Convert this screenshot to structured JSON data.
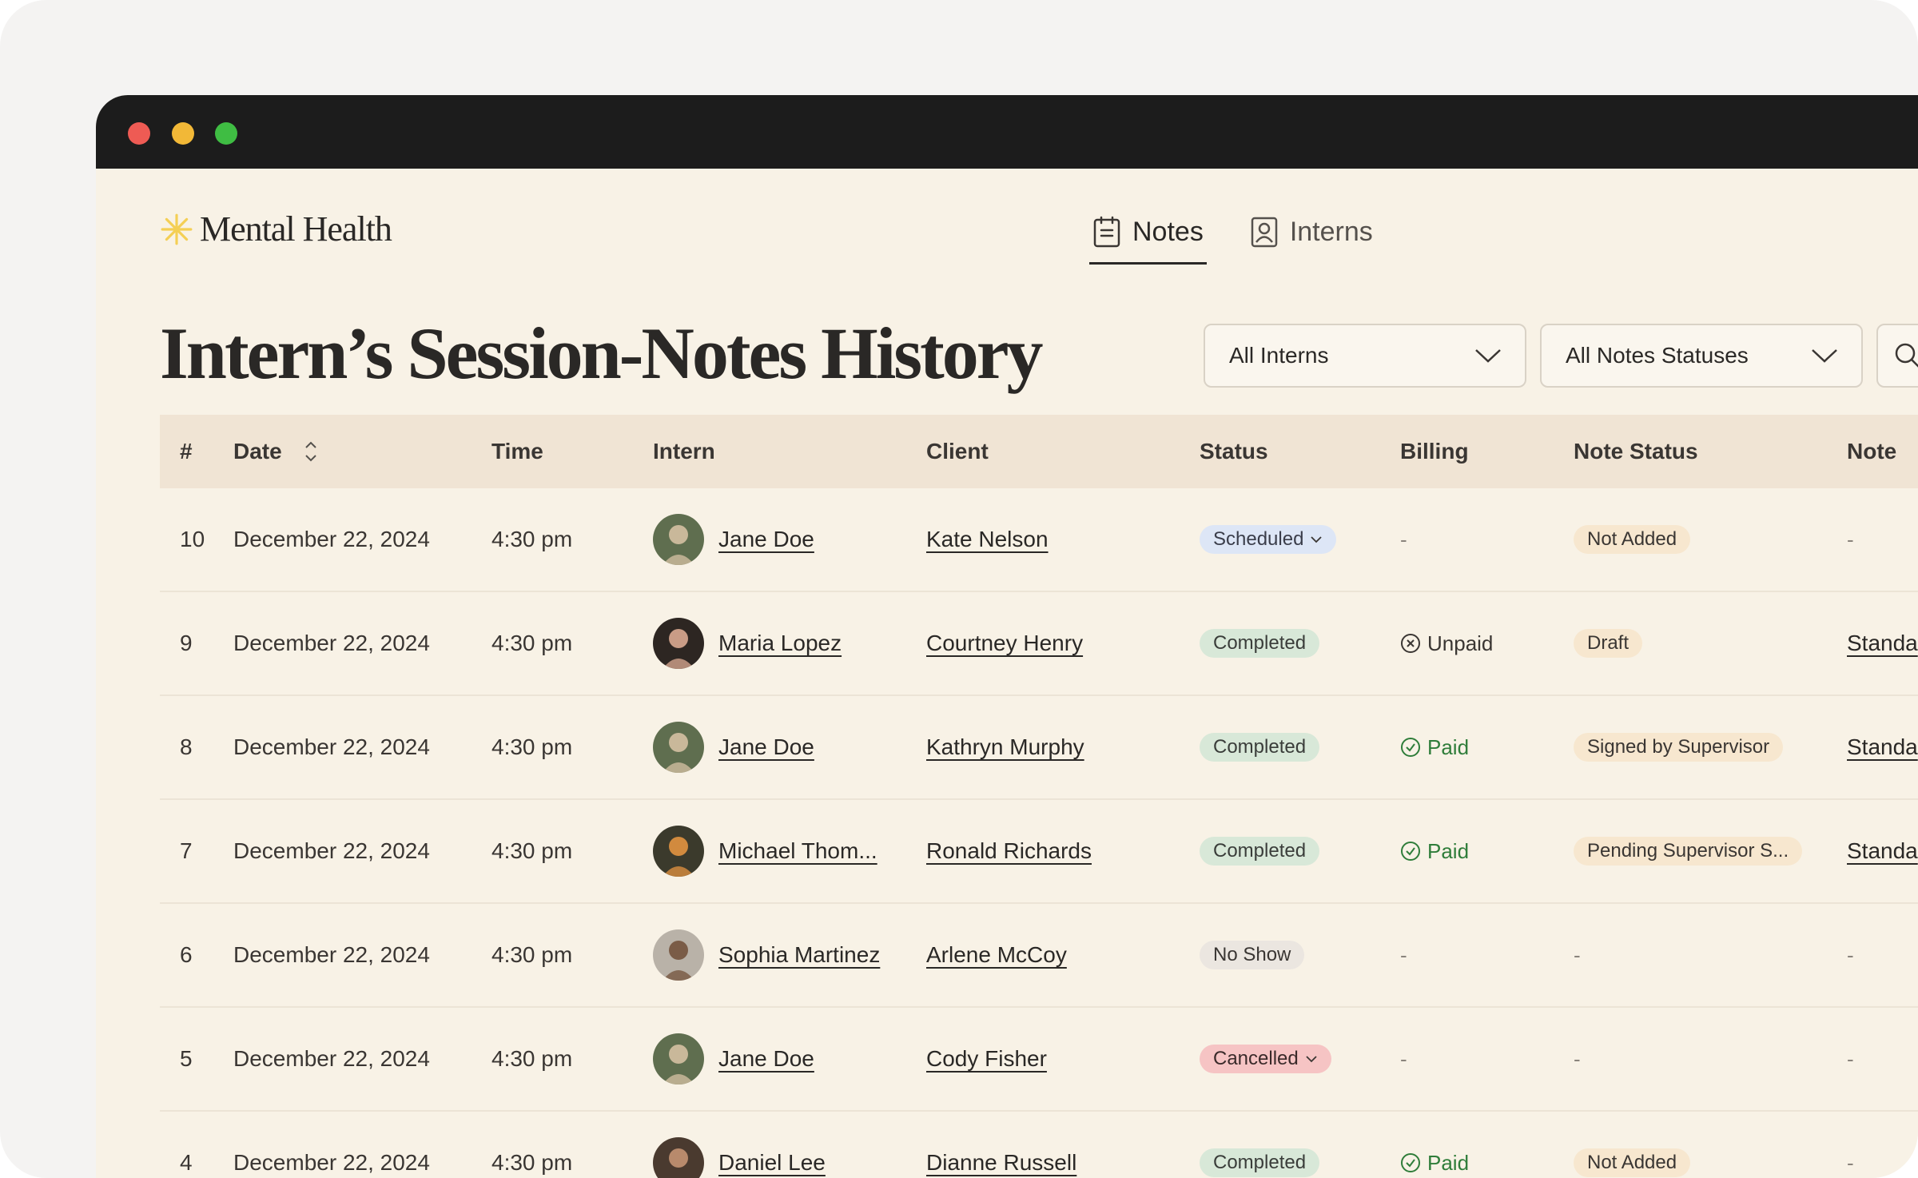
{
  "app": {
    "name": "Mental Health"
  },
  "nav": {
    "tabs": [
      {
        "label": "Notes"
      },
      {
        "label": "Interns"
      }
    ]
  },
  "page": {
    "title": "Intern’s Session-Notes History"
  },
  "filters": {
    "interns": "All Interns",
    "statuses": "All Notes Statuses"
  },
  "table": {
    "headers": {
      "num": "#",
      "date": "Date",
      "time": "Time",
      "intern": "Intern",
      "client": "Client",
      "status": "Status",
      "billing": "Billing",
      "note_status": "Note Status",
      "note": "Note"
    },
    "rows": [
      {
        "num": "10",
        "date": "December 22, 2024",
        "time": "4:30 pm",
        "intern": "Jane Doe",
        "client": "Kate Nelson",
        "status": "Scheduled",
        "billing": "-",
        "note_status": "Not Added",
        "note": "-"
      },
      {
        "num": "9",
        "date": "December 22, 2024",
        "time": "4:30 pm",
        "intern": "Maria Lopez",
        "client": "Courtney Henry",
        "status": "Completed",
        "billing": "Unpaid",
        "note_status": "Draft",
        "note": "Standa"
      },
      {
        "num": "8",
        "date": "December 22, 2024",
        "time": "4:30 pm",
        "intern": "Jane Doe",
        "client": "Kathryn Murphy",
        "status": "Completed",
        "billing": "Paid",
        "note_status": "Signed by Supervisor",
        "note": "Standa"
      },
      {
        "num": "7",
        "date": "December 22, 2024",
        "time": "4:30 pm",
        "intern": "Michael Thom...",
        "client": "Ronald Richards",
        "status": "Completed",
        "billing": "Paid",
        "note_status": "Pending Supervisor S...",
        "note": "Standa"
      },
      {
        "num": "6",
        "date": "December 22, 2024",
        "time": "4:30 pm",
        "intern": "Sophia Martinez",
        "client": "Arlene McCoy",
        "status": "No Show",
        "billing": "-",
        "note_status": "-",
        "note": "-"
      },
      {
        "num": "5",
        "date": "December 22, 2024",
        "time": "4:30 pm",
        "intern": "Jane Doe",
        "client": "Cody Fisher",
        "status": "Cancelled",
        "billing": "-",
        "note_status": "-",
        "note": "-"
      },
      {
        "num": "4",
        "date": "December 22, 2024",
        "time": "4:30 pm",
        "intern": "Daniel Lee",
        "client": "Dianne Russell",
        "status": "Completed",
        "billing": "Paid",
        "note_status": "Not Added",
        "note": "-"
      }
    ]
  },
  "colors": {
    "paid": "#2f7d3a",
    "cancelled": "#f6c4c4",
    "scheduled": "#dde6f6",
    "completed": "#d8e8d8"
  },
  "icons": {
    "brand": "sparkle-icon",
    "notes": "clipboard-icon",
    "interns": "id-badge-icon",
    "sort": "sort-icon",
    "paid": "check-circle-icon",
    "unpaid": "x-circle-icon",
    "search": "search-icon"
  }
}
